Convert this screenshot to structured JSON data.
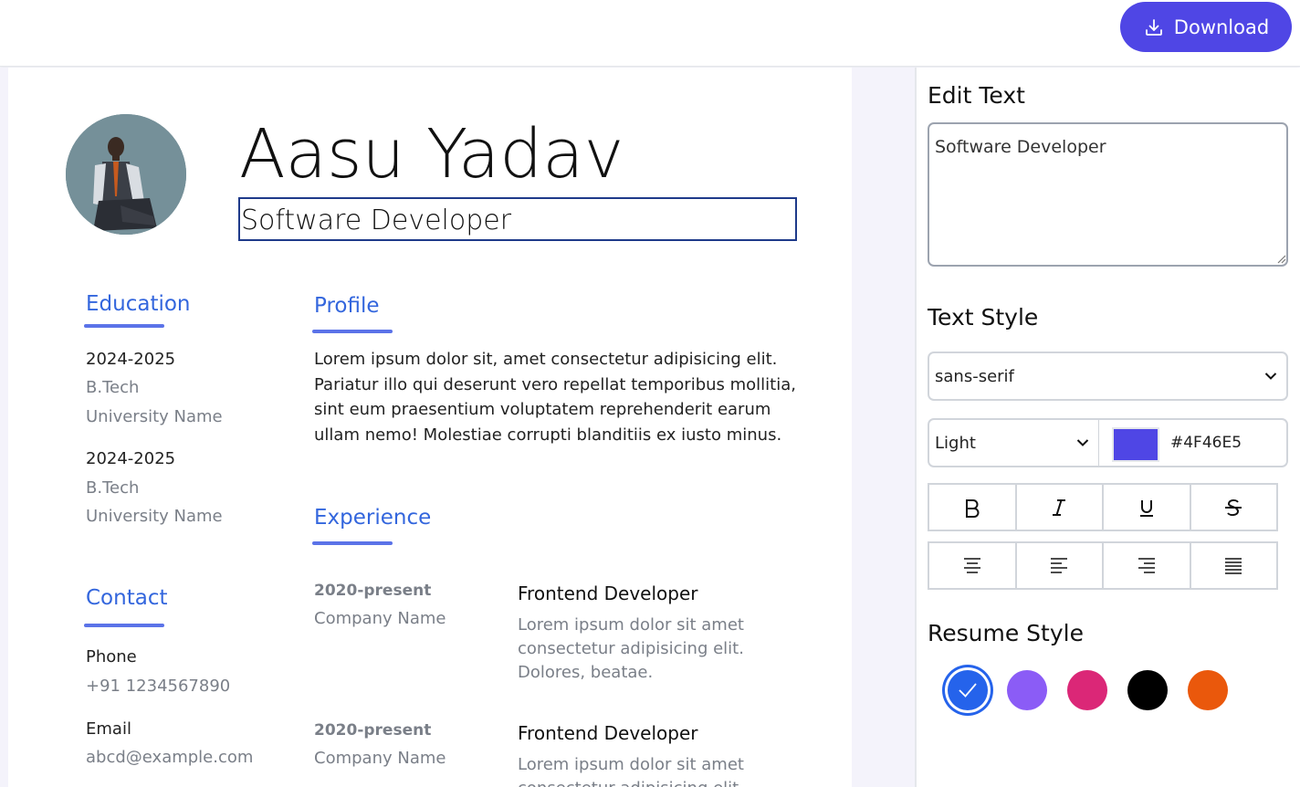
{
  "toolbar": {
    "download_label": "Download"
  },
  "resume": {
    "name": "Aasu Yadav",
    "title": "Software Developer",
    "education": {
      "heading": "Education",
      "items": [
        {
          "year": "2024-2025",
          "degree": "B.Tech",
          "school": "University Name"
        },
        {
          "year": "2024-2025",
          "degree": "B.Tech",
          "school": "University Name"
        }
      ]
    },
    "contact": {
      "heading": "Contact",
      "phone_label": "Phone",
      "phone": "+91 1234567890",
      "email_label": "Email",
      "email": "abcd@example.com"
    },
    "profile": {
      "heading": "Profile",
      "text": "Lorem ipsum dolor sit, amet consectetur adipisicing elit. Pariatur illo qui deserunt vero repellat temporibus mollitia, sint eum praesentium voluptatem reprehenderit earum ullam nemo! Molestiae corrupti blanditiis ex iusto minus."
    },
    "experience": {
      "heading": "Experience",
      "items": [
        {
          "date": "2020-present",
          "company": "Company Name",
          "role": "Frontend Developer",
          "desc": "Lorem ipsum dolor sit amet consectetur adipisicing elit. Dolores, beatae."
        },
        {
          "date": "2020-present",
          "company": "Company Name",
          "role": "Frontend Developer",
          "desc": "Lorem ipsum dolor sit amet consectetur adipisicing elit. Dolores, beatae."
        }
      ]
    }
  },
  "panel": {
    "edit_text_heading": "Edit Text",
    "edit_text_value": "Software Developer",
    "text_style_heading": "Text Style",
    "font_family": "sans-serif",
    "font_weight": "Light",
    "color_hex": "#4F46E5",
    "format_buttons": [
      "bold",
      "italic",
      "underline",
      "strikethrough"
    ],
    "align_buttons": [
      "align-center",
      "align-left",
      "align-right",
      "align-justify"
    ],
    "resume_style_heading": "Resume Style",
    "theme_colors": [
      "#2563eb",
      "#8b5cf6",
      "#db2777",
      "#000000",
      "#ea580c"
    ],
    "selected_theme": 0
  },
  "colors": {
    "accent": "#4f46e5",
    "heading": "#3366dd"
  }
}
